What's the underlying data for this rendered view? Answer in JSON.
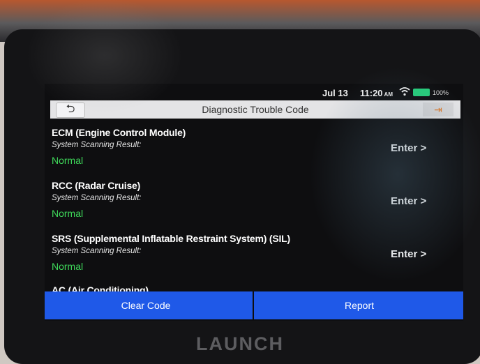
{
  "status_bar": {
    "date": "Jul 13",
    "time": "11:20",
    "ampm": "AM",
    "battery": "100%"
  },
  "header": {
    "title": "Diagnostic Trouble Code"
  },
  "systems": [
    {
      "name": "ECM (Engine Control Module)",
      "label": "System Scanning Result:",
      "status": "Normal",
      "action": "Enter >"
    },
    {
      "name": "RCC (Radar Cruise)",
      "label": "System Scanning Result:",
      "status": "Normal",
      "action": "Enter >"
    },
    {
      "name": "SRS (Supplemental Inflatable Restraint System) (SIL)",
      "label": "System Scanning Result:",
      "status": "Normal",
      "action": "Enter >"
    },
    {
      "name": "AC (Air Conditioning)"
    }
  ],
  "buttons": {
    "clear_code": "Clear Code",
    "report": "Report"
  },
  "device": {
    "brand": "LAUNCH"
  },
  "colors": {
    "accent_button": "#1f59e8",
    "status_normal": "#3fd85a",
    "battery": "#26d07c"
  }
}
